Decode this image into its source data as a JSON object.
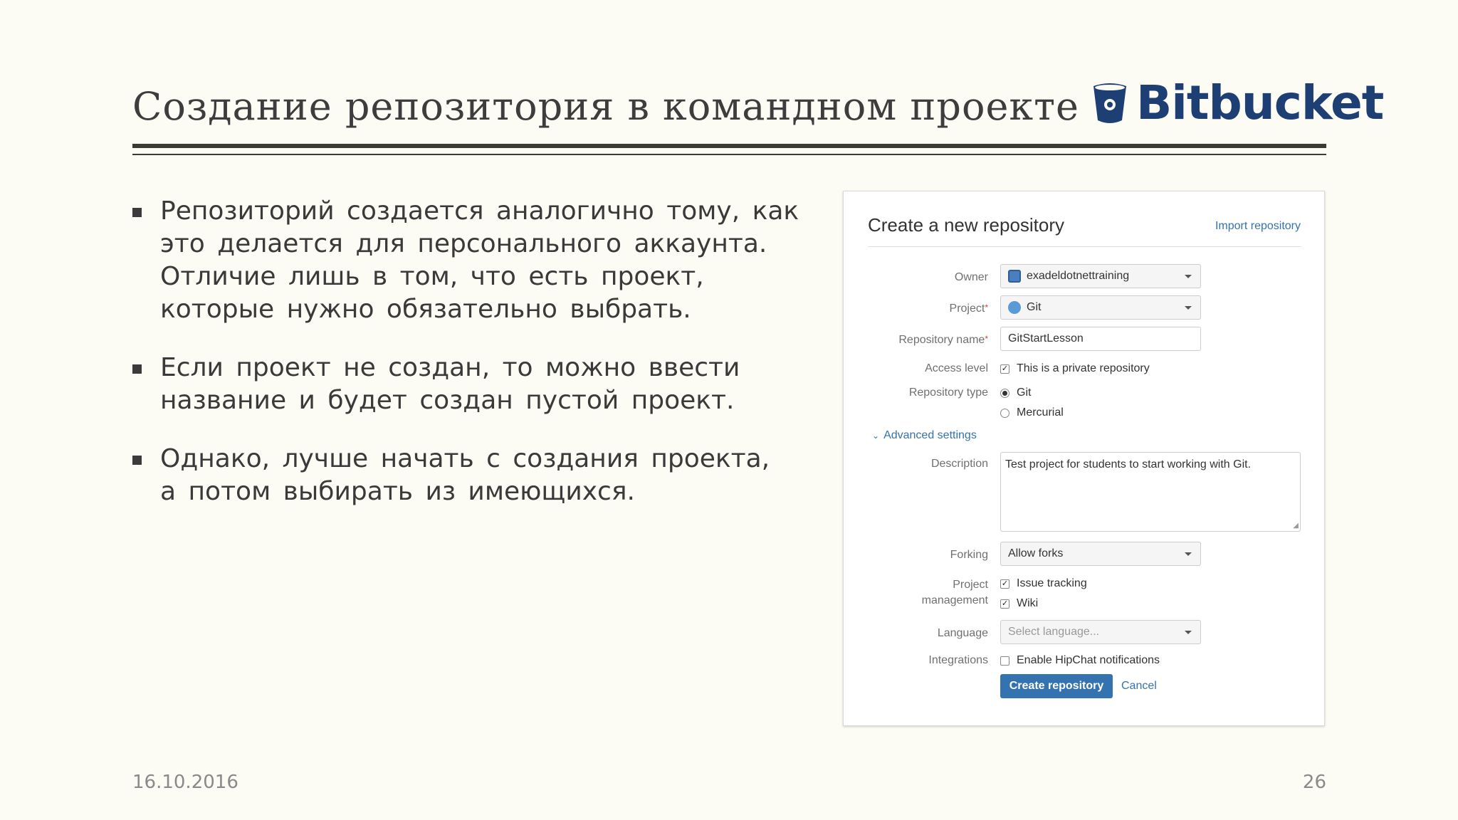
{
  "slide": {
    "title": "Создание репозитория в командном проекте",
    "logo_text": "Bitbucket",
    "bullets": [
      "Репозиторий создается аналогично тому, как это делается для персонального аккаунта. Отличие лишь в том, что есть проект, которые нужно обязательно выбрать.",
      "Если проект не создан, то можно ввести название и будет создан пустой проект.",
      "Однако, лучше начать с создания проекта, а потом выбирать из имеющихся."
    ],
    "date": "16.10.2016",
    "page_number": "26"
  },
  "form": {
    "title": "Create a new repository",
    "import_link": "Import repository",
    "owner": {
      "label": "Owner",
      "value": "exadeldotnettraining"
    },
    "project": {
      "label": "Project",
      "required_mark": "*",
      "value": "Git"
    },
    "repo_name": {
      "label": "Repository name",
      "required_mark": "*",
      "value": "GitStartLesson"
    },
    "access_level": {
      "label": "Access level",
      "option": "This is a private repository",
      "checked": true
    },
    "repo_type": {
      "label": "Repository type",
      "options": [
        "Git",
        "Mercurial"
      ],
      "selected": "Git"
    },
    "advanced_toggle": "Advanced settings",
    "description": {
      "label": "Description",
      "value": "Test project for students to start working with Git."
    },
    "forking": {
      "label": "Forking",
      "value": "Allow forks"
    },
    "project_management": {
      "label_line1": "Project",
      "label_line2": "management",
      "options": [
        "Issue tracking",
        "Wiki"
      ]
    },
    "language": {
      "label": "Language",
      "placeholder": "Select language..."
    },
    "integrations": {
      "label": "Integrations",
      "option": "Enable HipChat notifications",
      "checked": false
    },
    "create_button": "Create repository",
    "cancel_link": "Cancel"
  },
  "colors": {
    "background": "#fcfbf4",
    "logo": "#1d3f73",
    "link": "#3572b0",
    "primary_button": "#3572b0"
  }
}
